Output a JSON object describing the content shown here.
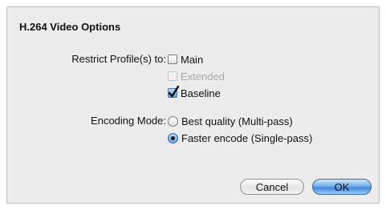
{
  "dialog": {
    "title": "H.264 Video Options"
  },
  "profiles": {
    "label": "Restrict Profile(s) to:",
    "options": [
      {
        "label": "Main",
        "checked": false,
        "enabled": true
      },
      {
        "label": "Extended",
        "checked": false,
        "enabled": false
      },
      {
        "label": "Baseline",
        "checked": true,
        "enabled": true
      }
    ]
  },
  "encoding": {
    "label": "Encoding Mode:",
    "options": [
      {
        "label": "Best quality (Multi-pass)",
        "selected": false
      },
      {
        "label": "Faster encode (Single-pass)",
        "selected": true
      }
    ]
  },
  "buttons": {
    "cancel": "Cancel",
    "ok": "OK"
  }
}
